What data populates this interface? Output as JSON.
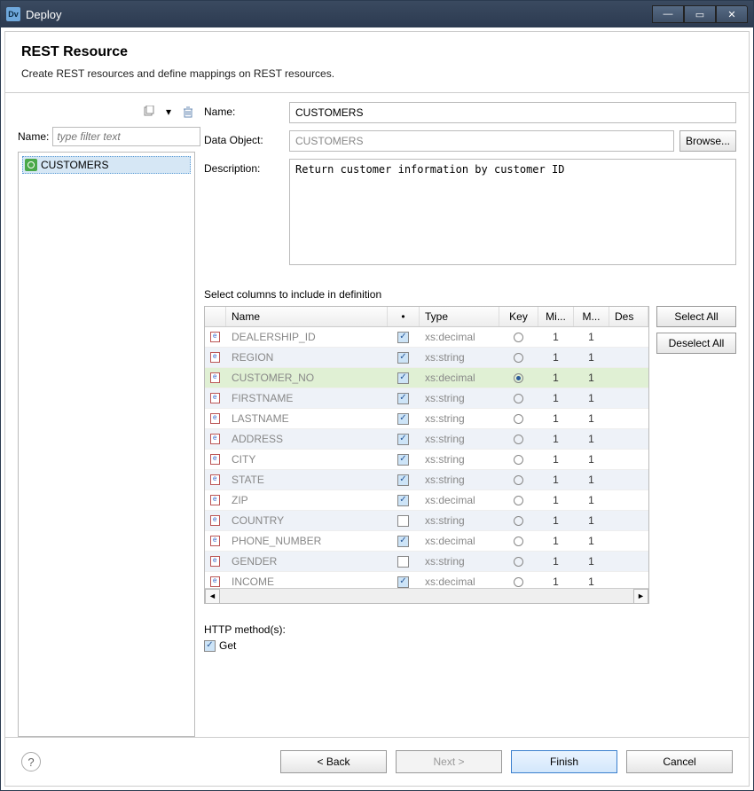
{
  "window": {
    "title": "Deploy",
    "app_icon_text": "Dv"
  },
  "win_controls": {
    "min": "—",
    "max": "▭",
    "close": "✕"
  },
  "header": {
    "title": "REST Resource",
    "subtitle": "Create REST resources and define mappings on REST resources."
  },
  "left": {
    "name_label": "Name:",
    "filter_placeholder": "type filter text",
    "tree": {
      "item": "CUSTOMERS"
    },
    "dropdown_caret": "▾"
  },
  "form": {
    "name_label": "Name:",
    "name_value": "CUSTOMERS",
    "data_object_label": "Data Object:",
    "data_object_value": "CUSTOMERS",
    "browse_label": "Browse...",
    "description_label": "Description:",
    "description_value": "Return customer information by customer ID"
  },
  "columns": {
    "section_label": "Select columns to include in definition",
    "headers": {
      "name": "Name",
      "include_dot": "•",
      "type": "Type",
      "key": "Key",
      "min": "Mi...",
      "max": "M...",
      "desc": "Des"
    },
    "rows": [
      {
        "name": "DEALERSHIP_ID",
        "type": "xs:decimal",
        "checked": true,
        "key": false,
        "min": "1",
        "max": "1",
        "alt": false
      },
      {
        "name": "REGION",
        "type": "xs:string",
        "checked": true,
        "key": false,
        "min": "1",
        "max": "1",
        "alt": true
      },
      {
        "name": "CUSTOMER_NO",
        "type": "xs:decimal",
        "checked": true,
        "key": true,
        "min": "1",
        "max": "1",
        "selected": true
      },
      {
        "name": "FIRSTNAME",
        "type": "xs:string",
        "checked": true,
        "key": false,
        "min": "1",
        "max": "1",
        "alt": true
      },
      {
        "name": "LASTNAME",
        "type": "xs:string",
        "checked": true,
        "key": false,
        "min": "1",
        "max": "1",
        "alt": false
      },
      {
        "name": "ADDRESS",
        "type": "xs:string",
        "checked": true,
        "key": false,
        "min": "1",
        "max": "1",
        "alt": true
      },
      {
        "name": "CITY",
        "type": "xs:string",
        "checked": true,
        "key": false,
        "min": "1",
        "max": "1",
        "alt": false
      },
      {
        "name": "STATE",
        "type": "xs:string",
        "checked": true,
        "key": false,
        "min": "1",
        "max": "1",
        "alt": true
      },
      {
        "name": "ZIP",
        "type": "xs:decimal",
        "checked": true,
        "key": false,
        "min": "1",
        "max": "1",
        "alt": false
      },
      {
        "name": "COUNTRY",
        "type": "xs:string",
        "checked": false,
        "key": false,
        "min": "1",
        "max": "1",
        "alt": true
      },
      {
        "name": "PHONE_NUMBER",
        "type": "xs:decimal",
        "checked": true,
        "key": false,
        "min": "1",
        "max": "1",
        "alt": false
      },
      {
        "name": "GENDER",
        "type": "xs:string",
        "checked": false,
        "key": false,
        "min": "1",
        "max": "1",
        "alt": true
      },
      {
        "name": "INCOME",
        "type": "xs:decimal",
        "checked": true,
        "key": false,
        "min": "1",
        "max": "1",
        "alt": false
      }
    ],
    "select_all": "Select All",
    "deselect_all": "Deselect All",
    "scroll_left": "◄",
    "scroll_right": "►"
  },
  "http": {
    "label": "HTTP method(s):",
    "get_label": "Get",
    "get_checked": true
  },
  "footer": {
    "help": "?",
    "back": "< Back",
    "next": "Next >",
    "finish": "Finish",
    "cancel": "Cancel"
  }
}
